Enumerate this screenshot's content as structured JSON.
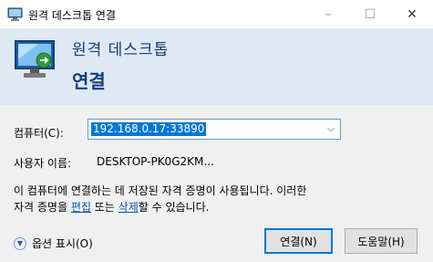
{
  "window": {
    "title": "원격 데스크톱 연결",
    "controls": {
      "minimize": "–",
      "maximize": "☐",
      "close": "✕"
    }
  },
  "banner": {
    "title": "원격 데스크톱",
    "subtitle": "연결",
    "icon": "remote-desktop-icon",
    "background": "#dfe9f4",
    "text_color": "#123f7a"
  },
  "form": {
    "computer_label": "컴퓨터(C):",
    "computer_value": "192.168.0.17:33890",
    "user_label": "사용자 이름:",
    "user_value": "DESKTOP-PK0G2KM..."
  },
  "note": {
    "line1": "이 컴퓨터에 연결하는 데 저장된 자격 증명이 사용됩니다. 이러한",
    "line2_prefix": "자격 증명을 ",
    "edit_link": "편집",
    "middle": " 또는 ",
    "delete_link": "삭제",
    "suffix": "할 수 있습니다."
  },
  "footer": {
    "options_label": "옵션 표시(O)",
    "connect_button": "연결(N)",
    "help_button": "도움말(H)"
  },
  "colors": {
    "accent": "#0078d7",
    "link": "#0b53b7"
  }
}
